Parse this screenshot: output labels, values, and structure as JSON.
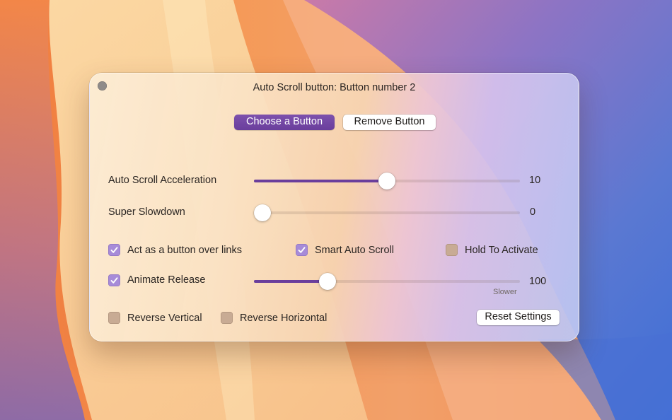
{
  "window": {
    "title": "Auto Scroll button: Button number 2"
  },
  "buttons": {
    "choose": "Choose a Button",
    "remove": "Remove Button",
    "reset": "Reset Settings"
  },
  "sliders": {
    "acceleration": {
      "label": "Auto Scroll Acceleration",
      "value": "10",
      "fraction": 0.5
    },
    "slowdown": {
      "label": "Super Slowdown",
      "value": "0",
      "fraction": 0.0
    },
    "release": {
      "label": "Animate Release",
      "value": "100",
      "fraction": 0.26,
      "hint": "Slower"
    }
  },
  "checkboxes": {
    "act_as_button": {
      "label": "Act as a button over links",
      "checked": true
    },
    "smart_auto_scroll": {
      "label": "Smart Auto Scroll",
      "checked": true
    },
    "hold_to_activate": {
      "label": "Hold To Activate",
      "checked": false
    },
    "animate_release": {
      "label": "Animate Release",
      "checked": true
    },
    "reverse_vertical": {
      "label": "Reverse Vertical",
      "checked": false
    },
    "reverse_horizontal": {
      "label": "Reverse Horizontal",
      "checked": false
    }
  },
  "colors": {
    "accent": "#6a3e9c",
    "checkbox_on": "#a78bd8",
    "checkbox_off": "#c8ab94"
  }
}
